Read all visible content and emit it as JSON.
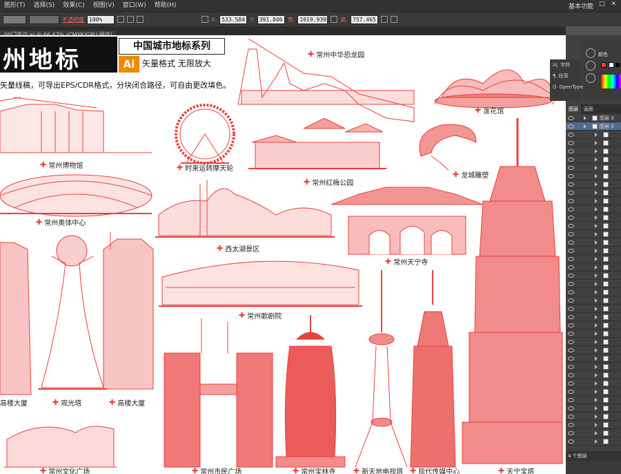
{
  "menu": {
    "items": [
      "图形(T)",
      "选择(S)",
      "效果(C)",
      "视图(V)",
      "窗口(W)",
      "帮助(H)"
    ],
    "workspace": "基本功能",
    "window_controls": "— □ ✕"
  },
  "control_bar": {
    "opacity_label": "不透明度",
    "opacity_value": "100%",
    "x_label": "X:",
    "x_value": "533.584",
    "y_label": "Y:",
    "y_value": "391.846",
    "w_label": "宽:",
    "w_value": "1019.939",
    "h_label": "高:",
    "h_value": "757.465"
  },
  "document_tab": "00门花边.ai @ 66.67% (CMYK/GPU 预览)",
  "artwork": {
    "title": "州地标",
    "series": "中国城市地标系列",
    "ai_badge": "Ai",
    "format_tag": "矢量格式 无限放大",
    "description": "矢量线稿，可导出EPS/CDR格式，分块闭合路径，可自由更改填色。",
    "marker_glyph": "✚",
    "landmarks": [
      "常州中华恐龙园",
      "莲花馆",
      "常州博物馆",
      "时来运转摩天轮",
      "常州红梅公园",
      "龙城雕塑",
      "常州奥体中心",
      "西太湖景区",
      "常州天宁寺",
      "常州歌剧院",
      "高楼大厦",
      "观光塔",
      "高楼大厦",
      "常州文化广场",
      "常州市民广场",
      "常州宝林寺",
      "新天地电视塔",
      "现代传媒中心",
      "天宁宝塔"
    ]
  },
  "character_panel": {
    "items": [
      "字符",
      "段落",
      "OpenType"
    ]
  },
  "color_panel": {
    "tabs": "颜色",
    "fill_color": "#e8403c"
  },
  "layers_panel": {
    "tabs": [
      "图层",
      "画板"
    ],
    "layers": [
      "图层 3",
      "图层 5"
    ],
    "footer": "4 个图层"
  },
  "colors": {
    "stroke": "#e8403c",
    "canvas": "#ffffff",
    "ui_dark": "#323232"
  }
}
